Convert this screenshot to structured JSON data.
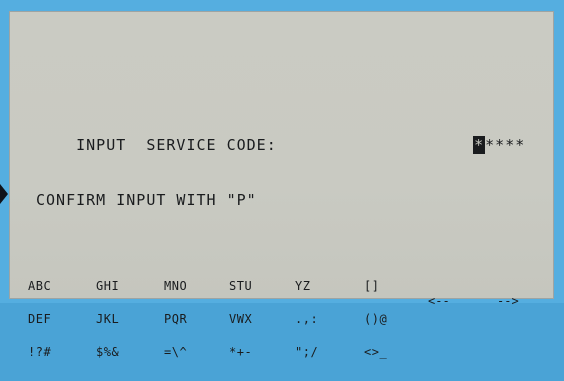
{
  "prompt": {
    "label": "INPUT  SERVICE CODE:"
  },
  "code": {
    "cursor_char": "*",
    "masked": "****"
  },
  "confirm": "CONFIRM INPUT WITH \"P\"",
  "keys": [
    {
      "rows": [
        "ABC",
        "DEF",
        "!?#"
      ]
    },
    {
      "rows": [
        "GHI",
        "JKL",
        "$%&"
      ]
    },
    {
      "rows": [
        "MNO",
        "PQR",
        "=\\^"
      ]
    },
    {
      "rows": [
        "STU",
        "VWX",
        "*+-"
      ]
    },
    {
      "rows": [
        "YZ",
        ".,:",
        "\";/"
      ]
    },
    {
      "rows": [
        "[]",
        "()@",
        "<>_"
      ]
    }
  ],
  "nav": {
    "back": "<--",
    "forward": "-->"
  }
}
